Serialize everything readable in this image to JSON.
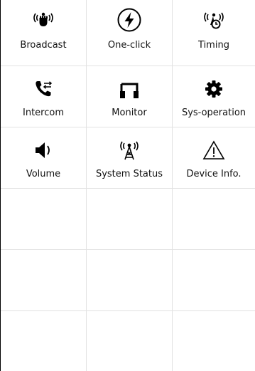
{
  "menu": {
    "items": [
      {
        "label": "Broadcast",
        "icon": "broadcast-hand-icon"
      },
      {
        "label": "One-click",
        "icon": "lightning-circle-icon"
      },
      {
        "label": "Timing",
        "icon": "timer-broadcast-icon"
      },
      {
        "label": "Intercom",
        "icon": "phone-transfer-icon"
      },
      {
        "label": "Monitor",
        "icon": "headphones-icon"
      },
      {
        "label": "Sys-operation",
        "icon": "gear-icon"
      },
      {
        "label": "Volume",
        "icon": "speaker-volume-icon"
      },
      {
        "label": "System Status",
        "icon": "antenna-tower-icon"
      },
      {
        "label": "Device Info.",
        "icon": "warning-triangle-icon"
      }
    ]
  }
}
